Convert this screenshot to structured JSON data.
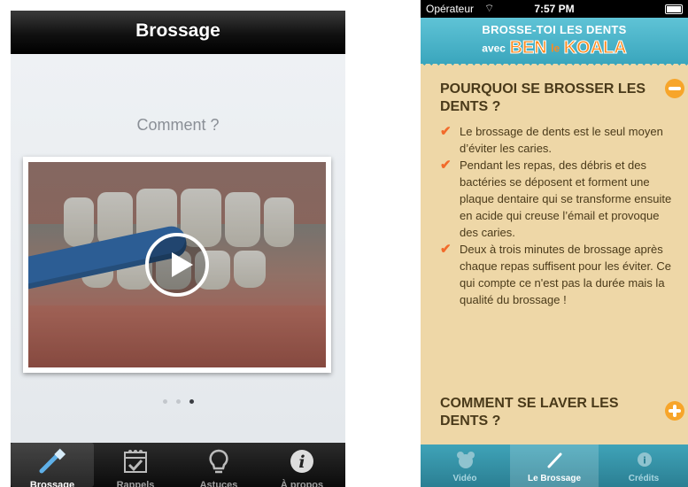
{
  "left": {
    "nav_title": "Brossage",
    "heading": "Comment ?",
    "page_dots": 3,
    "active_dot": 2,
    "tabs": [
      {
        "label": "Brossage",
        "icon": "toothbrush-icon",
        "selected": true
      },
      {
        "label": "Rappels",
        "icon": "calendar-check-icon",
        "selected": false
      },
      {
        "label": "Astuces",
        "icon": "lightbulb-icon",
        "selected": false
      },
      {
        "label": "À propos",
        "icon": "info-icon",
        "selected": false
      }
    ]
  },
  "right": {
    "status": {
      "carrier": "Opérateur",
      "time": "7:57 PM"
    },
    "banner": {
      "line1": "BROSSE-TOI LES DENTS",
      "avec": "avec",
      "ben": "BEN",
      "le": "le",
      "koala": "KOALA"
    },
    "section1": {
      "title": "POURQUOI SE BROSSER LES DENTS ?",
      "items": [
        "Le brossage de dents est le seul moyen d’éviter les caries.",
        "Pendant les repas, des débris et des bactéries se déposent et forment une plaque dentaire qui se transforme ensuite en acide qui creuse l’émail et provoque des caries.",
        "Deux à trois minutes de brossage après chaque repas suffisent pour les éviter. Ce qui compte ce n'est pas la durée mais la qualité du brossage !"
      ]
    },
    "section2": {
      "title": "COMMENT SE LAVER LES DENTS ?"
    },
    "tabs": [
      {
        "label": "Vidéo",
        "icon": "koala-icon",
        "selected": false
      },
      {
        "label": "Le Brossage",
        "icon": "toothbrush-icon",
        "selected": true
      },
      {
        "label": "Crédits",
        "icon": "info-icon",
        "selected": false
      }
    ]
  },
  "colors": {
    "accent_orange": "#f7a52a",
    "banner_blue": "#3aa6bd",
    "panel_beige": "#eed7a7"
  }
}
